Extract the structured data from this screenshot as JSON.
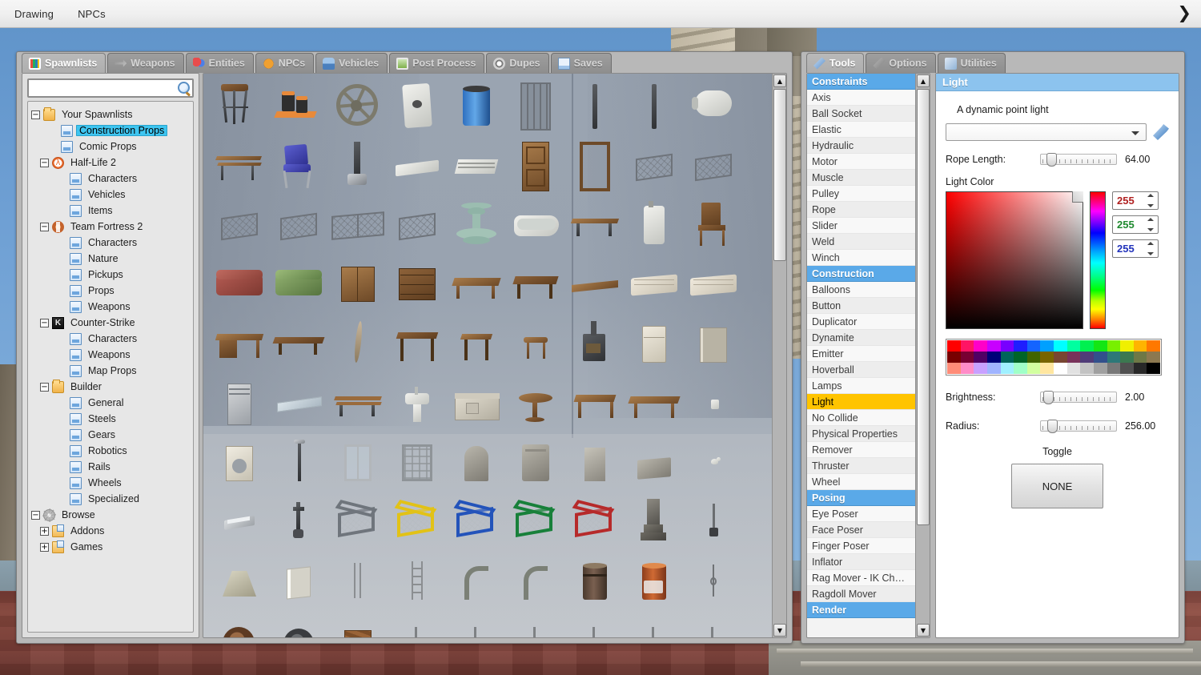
{
  "menubar": {
    "items": [
      {
        "label": "Drawing",
        "name": "menu-drawing"
      },
      {
        "label": "NPCs",
        "name": "menu-npcs"
      }
    ],
    "chevron": "❯"
  },
  "spawnmenu": {
    "tabs": [
      {
        "label": "Spawnlists",
        "icon": "spawnlists-icon",
        "active": true
      },
      {
        "label": "Weapons",
        "icon": "weapons-icon",
        "active": false
      },
      {
        "label": "Entities",
        "icon": "entities-icon",
        "active": false
      },
      {
        "label": "NPCs",
        "icon": "npcs-icon",
        "active": false
      },
      {
        "label": "Vehicles",
        "icon": "vehicles-icon",
        "active": false
      },
      {
        "label": "Post Process",
        "icon": "postprocess-icon",
        "active": false
      },
      {
        "label": "Dupes",
        "icon": "dupes-icon",
        "active": false
      },
      {
        "label": "Saves",
        "icon": "saves-icon",
        "active": false
      }
    ],
    "search": {
      "value": "",
      "placeholder": ""
    },
    "tree": [
      {
        "label": "Your Spawnlists",
        "indent": 0,
        "icon": "folder",
        "expander": "−",
        "selected": false
      },
      {
        "label": "Construction Props",
        "indent": 1,
        "icon": "doc",
        "expander": "",
        "selected": true
      },
      {
        "label": "Comic Props",
        "indent": 1,
        "icon": "doc",
        "expander": "",
        "selected": false
      },
      {
        "label": "Half-Life 2",
        "indent": 0.5,
        "icon": "hl2",
        "expander": "−",
        "selected": false
      },
      {
        "label": "Characters",
        "indent": 1.5,
        "icon": "doc",
        "expander": "",
        "selected": false
      },
      {
        "label": "Vehicles",
        "indent": 1.5,
        "icon": "doc",
        "expander": "",
        "selected": false
      },
      {
        "label": "Items",
        "indent": 1.5,
        "icon": "doc",
        "expander": "",
        "selected": false
      },
      {
        "label": "Team Fortress 2",
        "indent": 0.5,
        "icon": "tf2",
        "expander": "−",
        "selected": false
      },
      {
        "label": "Characters",
        "indent": 1.5,
        "icon": "doc",
        "expander": "",
        "selected": false
      },
      {
        "label": "Nature",
        "indent": 1.5,
        "icon": "doc",
        "expander": "",
        "selected": false
      },
      {
        "label": "Pickups",
        "indent": 1.5,
        "icon": "doc",
        "expander": "",
        "selected": false
      },
      {
        "label": "Props",
        "indent": 1.5,
        "icon": "doc",
        "expander": "",
        "selected": false
      },
      {
        "label": "Weapons",
        "indent": 1.5,
        "icon": "doc",
        "expander": "",
        "selected": false
      },
      {
        "label": "Counter-Strike",
        "indent": 0.5,
        "icon": "cs",
        "expander": "−",
        "selected": false
      },
      {
        "label": "Characters",
        "indent": 1.5,
        "icon": "doc",
        "expander": "",
        "selected": false
      },
      {
        "label": "Weapons",
        "indent": 1.5,
        "icon": "doc",
        "expander": "",
        "selected": false
      },
      {
        "label": "Map Props",
        "indent": 1.5,
        "icon": "doc",
        "expander": "",
        "selected": false
      },
      {
        "label": "Builder",
        "indent": 0.5,
        "icon": "folder",
        "expander": "−",
        "selected": false
      },
      {
        "label": "General",
        "indent": 1.5,
        "icon": "doc",
        "expander": "",
        "selected": false
      },
      {
        "label": "Steels",
        "indent": 1.5,
        "icon": "doc",
        "expander": "",
        "selected": false
      },
      {
        "label": "Gears",
        "indent": 1.5,
        "icon": "doc",
        "expander": "",
        "selected": false
      },
      {
        "label": "Robotics",
        "indent": 1.5,
        "icon": "doc",
        "expander": "",
        "selected": false
      },
      {
        "label": "Rails",
        "indent": 1.5,
        "icon": "doc",
        "expander": "",
        "selected": false
      },
      {
        "label": "Wheels",
        "indent": 1.5,
        "icon": "doc",
        "expander": "",
        "selected": false
      },
      {
        "label": "Specialized",
        "indent": 1.5,
        "icon": "doc",
        "expander": "",
        "selected": false
      },
      {
        "label": "Browse",
        "indent": 0,
        "icon": "gear",
        "expander": "−",
        "selected": false
      },
      {
        "label": "Addons",
        "indent": 0.5,
        "icon": "folder-open",
        "expander": "+",
        "selected": false
      },
      {
        "label": "Games",
        "indent": 0.5,
        "icon": "folder-open",
        "expander": "+",
        "selected": false
      }
    ],
    "scrollbar": {
      "up": "▲",
      "down": "▼",
      "thumb_top_pct": 0,
      "thumb_height_pct": 30
    }
  },
  "toolmenu": {
    "tabs": [
      {
        "label": "Tools",
        "icon": "tools-icon",
        "active": true
      },
      {
        "label": "Options",
        "icon": "options-icon",
        "active": false
      },
      {
        "label": "Utilities",
        "icon": "utilities-icon",
        "active": false
      }
    ],
    "list": [
      {
        "type": "header",
        "label": "Constraints"
      },
      {
        "type": "item",
        "label": "Axis"
      },
      {
        "type": "item",
        "label": "Ball Socket"
      },
      {
        "type": "item",
        "label": "Elastic"
      },
      {
        "type": "item",
        "label": "Hydraulic"
      },
      {
        "type": "item",
        "label": "Motor"
      },
      {
        "type": "item",
        "label": "Muscle"
      },
      {
        "type": "item",
        "label": "Pulley"
      },
      {
        "type": "item",
        "label": "Rope"
      },
      {
        "type": "item",
        "label": "Slider"
      },
      {
        "type": "item",
        "label": "Weld"
      },
      {
        "type": "item",
        "label": "Winch"
      },
      {
        "type": "header",
        "label": "Construction"
      },
      {
        "type": "item",
        "label": "Balloons"
      },
      {
        "type": "item",
        "label": "Button"
      },
      {
        "type": "item",
        "label": "Duplicator"
      },
      {
        "type": "item",
        "label": "Dynamite"
      },
      {
        "type": "item",
        "label": "Emitter"
      },
      {
        "type": "item",
        "label": "Hoverball"
      },
      {
        "type": "item",
        "label": "Lamps"
      },
      {
        "type": "item",
        "label": "Light",
        "selected": true
      },
      {
        "type": "item",
        "label": "No Collide"
      },
      {
        "type": "item",
        "label": "Physical Properties"
      },
      {
        "type": "item",
        "label": "Remover"
      },
      {
        "type": "item",
        "label": "Thruster"
      },
      {
        "type": "item",
        "label": "Wheel"
      },
      {
        "type": "header",
        "label": "Posing"
      },
      {
        "type": "item",
        "label": "Eye Poser"
      },
      {
        "type": "item",
        "label": "Face Poser"
      },
      {
        "type": "item",
        "label": "Finger Poser"
      },
      {
        "type": "item",
        "label": "Inflator"
      },
      {
        "type": "item",
        "label": "Rag Mover - IK Ch…"
      },
      {
        "type": "item",
        "label": "Ragdoll Mover"
      },
      {
        "type": "header",
        "label": "Render"
      }
    ],
    "scrollbar": {
      "up": "▲",
      "down": "▼"
    },
    "properties": {
      "title": "Light",
      "description": "A dynamic point light",
      "preset_value": "",
      "rope_length": {
        "label": "Rope Length:",
        "value": "64.00",
        "knob_pct": 8
      },
      "light_color_label": "Light Color",
      "rgb": {
        "r": "255",
        "g": "255",
        "b": "255"
      },
      "spinner_up": "▲",
      "spinner_down": "▼",
      "brightness": {
        "label": "Brightness:",
        "value": "2.00",
        "knob_pct": 4
      },
      "radius": {
        "label": "Radius:",
        "value": "256.00",
        "knob_pct": 10
      },
      "toggle_label": "Toggle",
      "toggle_value": "NONE",
      "swatches": [
        "#ff0000",
        "#ff1464",
        "#ff00c8",
        "#c800ff",
        "#7800ff",
        "#1e1eff",
        "#1464ff",
        "#00a0ff",
        "#00ffff",
        "#00ffa0",
        "#00f050",
        "#14e614",
        "#78f000",
        "#f0f000",
        "#ffb400",
        "#ff7800",
        "#780000",
        "#780032",
        "#500064",
        "#000078",
        "#00645a",
        "#006428",
        "#406400",
        "#786400",
        "#784632",
        "#78325a",
        "#503c78",
        "#32508c",
        "#2d7878",
        "#3c7850",
        "#6e7846",
        "#8c7850",
        "#ff8c78",
        "#ff8cc8",
        "#c8a0ff",
        "#a0b4ff",
        "#a0f0ff",
        "#a0ffc8",
        "#d2ffa0",
        "#ffe6a0",
        "#ffffff",
        "#e1e1e1",
        "#c3c3c3",
        "#a0a0a0",
        "#787878",
        "#505050",
        "#282828",
        "#000000"
      ],
      "colors": {
        "header": "#8cc3ee",
        "section_header": "#5aa9e8",
        "selected": "#ffc400"
      }
    }
  },
  "prop_grid": {
    "columns": 9,
    "rows": [
      [
        "bar-stool",
        "paint-cans",
        "flywheel",
        "metal-plate",
        "blue-barrel",
        "jail-door",
        "pole",
        "pole",
        "gas-tank"
      ],
      [
        "wooden-bench",
        "blue-chair",
        "floor-lamp",
        "white-panel",
        "vent",
        "wooden-door",
        "doorframe",
        "chainlink-a",
        "chainlink-b"
      ],
      [
        "fence-small",
        "fence-small2",
        "fence-wide",
        "fence-angled",
        "fountain",
        "bathtub",
        "bench-metal",
        "water-heater",
        "wooden-chair"
      ],
      [
        "red-couch",
        "green-couch",
        "cabinet",
        "dresser",
        "table-low",
        "table-dark",
        "wooden-plank",
        "mattress-a",
        "mattress-b"
      ],
      [
        "desk",
        "coffee-table",
        "surfboard",
        "table-tall",
        "side-table",
        "stool-wood",
        "wood-stove",
        "fridge",
        "radiator"
      ],
      [
        "locker",
        "glass-panel",
        "park-bench",
        "sink",
        "counter",
        "round-table",
        "table-square",
        "table-wide",
        "mug"
      ],
      [
        "washer",
        "street-lamp",
        "window-frame",
        "window-grate",
        "gravestone-a",
        "gravestone-b",
        "gravestone-c",
        "gravestone-d",
        "bird"
      ],
      [
        "soap-bar",
        "sculpture",
        "cage-grey",
        "cage-yellow",
        "cage-blue",
        "cage-green",
        "cage-red",
        "monument",
        "hook"
      ],
      [
        "lampshade",
        "radiator-white",
        "rods",
        "ladder",
        "pipe-bend-a",
        "pipe-bend-b",
        "barrel-rust",
        "barrel-orange",
        "chain"
      ],
      [
        "wheel-rust",
        "wheel-dark",
        "crate-wood",
        "stick-a",
        "stick-b",
        "stick-c",
        "stick-d",
        "stick-e",
        "stick-f"
      ]
    ],
    "scrollbar": {
      "up": "▲",
      "down": "▼"
    }
  }
}
